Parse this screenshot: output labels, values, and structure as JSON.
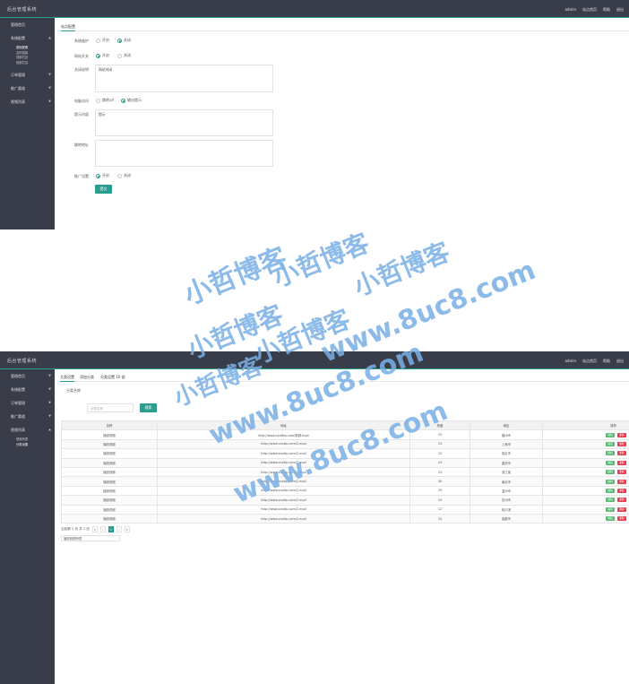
{
  "app": {
    "title": "后台管理系统",
    "nav": [
      "admin",
      "站点首页",
      "帮助",
      "退出"
    ]
  },
  "sidebar_form": {
    "items": [
      {
        "label": "管理首页"
      },
      {
        "label": "系统配置",
        "subitems": [
          "基础配置",
          "友情链接",
          "顶部栏目",
          "底部栏目"
        ]
      },
      {
        "label": "订单管理"
      },
      {
        "label": "推广渠道"
      },
      {
        "label": "视频列表"
      }
    ]
  },
  "sidebar_list": {
    "items": [
      {
        "label": "管理首页"
      },
      {
        "label": "系统配置"
      },
      {
        "label": "订单管理"
      },
      {
        "label": "推广渠道"
      },
      {
        "label": "视频列表",
        "subitems": [
          "视频列表",
          "分类设置"
        ]
      }
    ]
  },
  "form": {
    "tab": "站点配置",
    "rows": [
      {
        "label": "系统维护",
        "options": [
          "开启",
          "关闭"
        ],
        "selected": 1
      },
      {
        "label": "网站开关",
        "options": [
          "开启",
          "关闭"
        ],
        "selected": 0
      },
      {
        "label": "关闭说明",
        "value": "网站关闭"
      },
      {
        "label": "电脑访问",
        "options": [
          "跳转url",
          "输出提示"
        ],
        "selected": 1
      },
      {
        "label": "提示内容",
        "value": "提示"
      },
      {
        "label": "跳转地址",
        "value": ""
      },
      {
        "label": "推广设置",
        "options": [
          "开启",
          "关闭"
        ],
        "selected": 0
      }
    ],
    "submit": "提交"
  },
  "watermark": {
    "brand": "小哲博客",
    "url": "www.8uc8.com"
  },
  "list": {
    "tabs": [
      "大类设置",
      "添加分类",
      "分类设置 10 部"
    ],
    "search_label": "分类名称",
    "search_placeholder": "分类名称",
    "search_button": "搜索",
    "columns": [
      "名称",
      "地址",
      "热度",
      "地区",
      "操作"
    ],
    "rows": [
      {
        "name": "播放视频",
        "url": "http://www.xxxtttp.com/视频.mp4",
        "heat": "25",
        "region": "福州市"
      },
      {
        "name": "播放视频",
        "url": "http://www.xxxttp.com/2.mp4",
        "heat": "25",
        "region": "上海市"
      },
      {
        "name": "播放视频",
        "url": "http://www.xxxttp.com/2.mp4",
        "heat": "25",
        "region": "保定市"
      },
      {
        "name": "播放视频",
        "url": "http://www.xxxttp.com/2.mp4",
        "heat": "25",
        "region": "重庆市"
      },
      {
        "name": "播放视频",
        "url": "http://www.xxxttp.com/2.mp4",
        "heat": "25",
        "region": "浙江省"
      },
      {
        "name": "播放视频",
        "url": "http://www.xxxttp.com/2.mp4",
        "heat": "30",
        "region": "南京市"
      },
      {
        "name": "播放视频",
        "url": "http://www.xxxttp.com/2.mp4",
        "heat": "29",
        "region": "温州市"
      },
      {
        "name": "播放视频",
        "url": "http://www.xxxttp.com/2.mp4",
        "heat": "19",
        "region": "苏州市"
      },
      {
        "name": "播放视频",
        "url": "http://www.xxxttp.com/2.mp4",
        "heat": "12",
        "region": "哈尔滨"
      },
      {
        "name": "播放视频",
        "url": "http://www.xxxttp.com/2.mp4",
        "heat": "25",
        "region": "成都市"
      }
    ],
    "op_edit": "编辑",
    "op_delete": "删除",
    "pager_info": "当前第 1 页 共 1 页",
    "pager_first": "«",
    "pager_prev": "‹",
    "pager_current": "1",
    "pager_next": "›",
    "pager_last": "»",
    "page_select": "播放视频列表"
  }
}
